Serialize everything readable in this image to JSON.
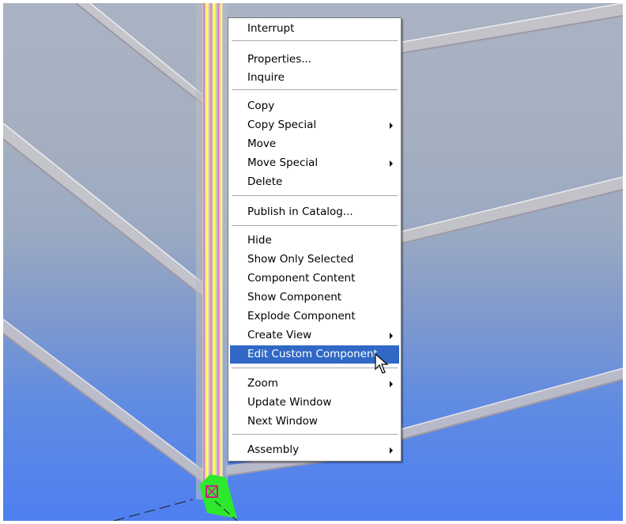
{
  "context_menu": {
    "groups": [
      [
        "Interrupt"
      ],
      [
        "Properties...",
        "Inquire"
      ],
      [
        "Copy",
        "Copy Special",
        "Move",
        "Move Special",
        "Delete"
      ],
      [
        "Publish in Catalog..."
      ],
      [
        "Hide",
        "Show Only Selected",
        "Component Content",
        "Show Component",
        "Explode Component",
        "Create View",
        "Edit Custom Component"
      ],
      [
        "Zoom",
        "Update Window",
        "Next Window"
      ],
      [
        "Assembly"
      ]
    ],
    "items": {
      "interrupt": "Interrupt",
      "properties": "Properties...",
      "inquire": "Inquire",
      "copy": "Copy",
      "copy_special": "Copy Special",
      "move": "Move",
      "move_special": "Move Special",
      "delete": "Delete",
      "publish_in_catalog": "Publish in Catalog...",
      "hide": "Hide",
      "show_only_selected": "Show Only Selected",
      "component_content": "Component Content",
      "show_component": "Show Component",
      "explode_component": "Explode Component",
      "create_view": "Create View",
      "edit_custom_component": "Edit Custom Component",
      "zoom": "Zoom",
      "update_window": "Update Window",
      "next_window": "Next Window",
      "assembly": "Assembly"
    },
    "highlighted": "Edit Custom Component",
    "submenu_items": [
      "Copy Special",
      "Move Special",
      "Create View",
      "Zoom",
      "Assembly"
    ]
  },
  "colors": {
    "menu_highlight": "#3168c6",
    "menu_background": "#ffffff",
    "column_highlight": "#ffff66",
    "column_outline": "#e080c8",
    "selection_marker": "#2ee82e",
    "sky_top": "#a9b3c3",
    "sky_bottom": "#4f7ff0"
  },
  "icons": [
    "submenu-arrow-icon",
    "mouse-pointer-icon",
    "selection-handle-icon"
  ]
}
